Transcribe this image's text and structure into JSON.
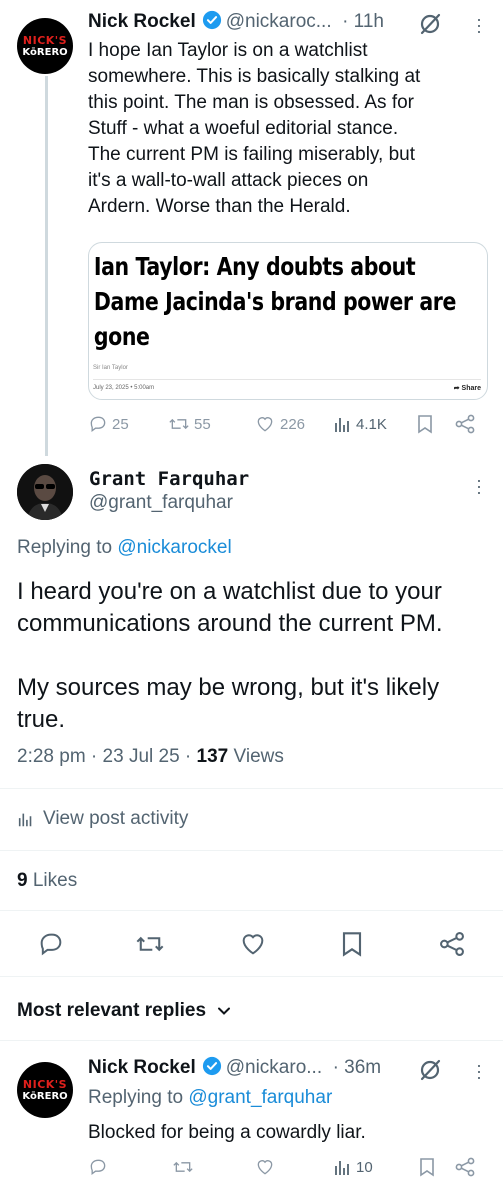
{
  "tweet1": {
    "avatar_line1": "NICK'S",
    "avatar_line2": "KōRERO",
    "name": "Nick Rockel",
    "handle": "@nickaroc...",
    "time": "· 11h",
    "text_lines": [
      "I hope Ian Taylor is on a watchlist",
      "somewhere. This is basically stalking at",
      "this point. The man is obsessed. As for",
      "Stuff - what a woeful editorial stance.",
      "The current PM is failing miserably, but",
      "it's a wall-to-wall attack pieces on",
      "Ardern. Worse than the Herald."
    ],
    "card": {
      "headline_lines": [
        "Ian Taylor: Any doubts about",
        "Dame Jacinda's brand power are",
        "gone"
      ],
      "byline": "Sir Ian Taylor",
      "date": "July 23, 2025 • 5:00am",
      "share": "Share"
    },
    "actions": {
      "replies": "25",
      "reposts": "55",
      "likes": "226",
      "views": "4.1K"
    }
  },
  "main_tweet": {
    "name": "Grant Farquhar",
    "handle": "@grant_farquhar",
    "replying_prefix": "Replying to",
    "replying_to": "@nickarockel",
    "text_paragraphs": [
      [
        "I heard you're on a watchlist due to your",
        "communications around the current PM."
      ],
      [
        "My sources may be wrong, but it's likely",
        "true."
      ]
    ],
    "time": "2:28 pm · 23 Jul 25 ·",
    "views_count": "137",
    "views_label": "Views",
    "activity_label": "View post activity",
    "likes_count": "9",
    "likes_label": "Likes"
  },
  "replies_header": "Most relevant replies",
  "reply1": {
    "avatar_line1": "NICK'S",
    "avatar_line2": "KōRERO",
    "name": "Nick Rockel",
    "handle": "@nickaro...",
    "time": "· 36m",
    "replying_prefix": "Replying to",
    "replying_to": "@grant_farquhar",
    "text": "Blocked for being a cowardly liar.",
    "views": "10"
  },
  "colors": {
    "accent": "#1d9bf0",
    "muted": "#536471",
    "verified": "#1d9bf0",
    "brand_red": "#e0201c"
  }
}
